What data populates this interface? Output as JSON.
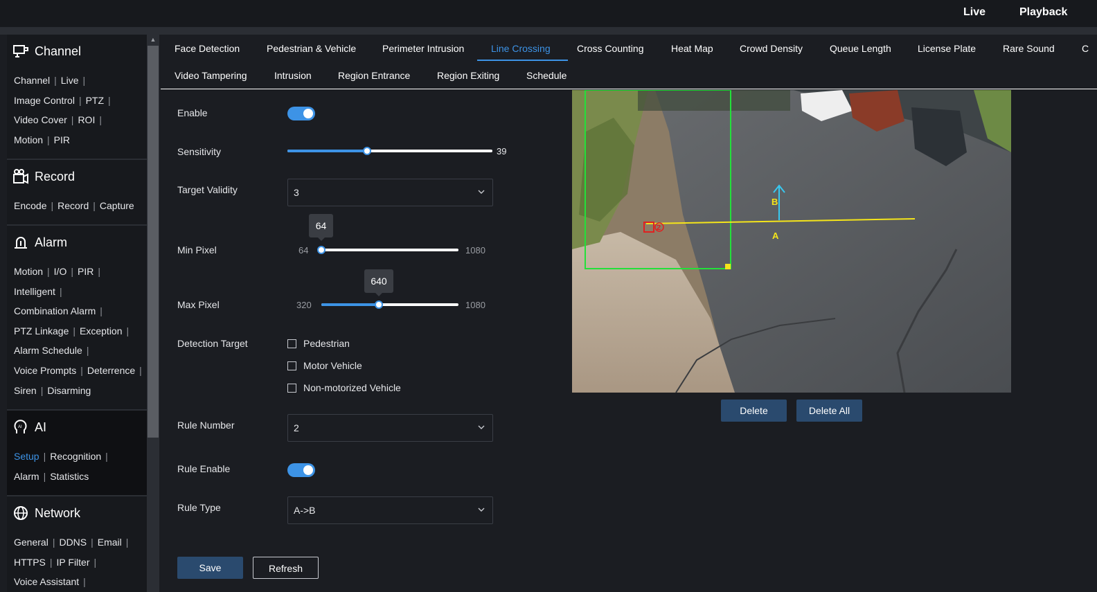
{
  "topnav": {
    "live": "Live",
    "playback": "Playback"
  },
  "sidebar": {
    "channel": {
      "title": "Channel",
      "rows": [
        [
          "Channel",
          "Live"
        ],
        [
          "Image Control",
          "PTZ"
        ],
        [
          "Video Cover",
          "ROI"
        ],
        [
          "Motion",
          "PIR"
        ]
      ]
    },
    "record": {
      "title": "Record",
      "rows": [
        [
          "Encode",
          "Record",
          "Capture"
        ]
      ]
    },
    "alarm": {
      "title": "Alarm",
      "rows": [
        [
          "Motion",
          "I/O",
          "PIR"
        ],
        [
          "Intelligent"
        ],
        [
          "Combination Alarm"
        ],
        [
          "PTZ Linkage",
          "Exception"
        ],
        [
          "Alarm Schedule"
        ],
        [
          "Voice Prompts",
          "Deterrence"
        ],
        [
          "Siren",
          "Disarming"
        ]
      ]
    },
    "ai": {
      "title": "AI",
      "rows": [
        [
          "Setup",
          "Recognition"
        ],
        [
          "Alarm",
          "Statistics"
        ]
      ],
      "selected": "Setup"
    },
    "network": {
      "title": "Network",
      "rows": [
        [
          "General",
          "DDNS",
          "Email"
        ],
        [
          "HTTPS",
          "IP Filter"
        ],
        [
          "Voice Assistant"
        ]
      ]
    }
  },
  "tabs": {
    "row1": [
      "Face Detection",
      "Pedestrian & Vehicle",
      "Perimeter Intrusion",
      "Line Crossing",
      "Cross Counting",
      "Heat Map",
      "Crowd Density",
      "Queue Length",
      "License Plate",
      "Rare Sound",
      "C"
    ],
    "row2": [
      "Video Tampering",
      "Intrusion",
      "Region Entrance",
      "Region Exiting",
      "Schedule"
    ],
    "active": "Line Crossing"
  },
  "form": {
    "enable_label": "Enable",
    "enable_on": true,
    "sensitivity_label": "Sensitivity",
    "sensitivity_value": "39",
    "sensitivity_fraction": 0.39,
    "target_validity_label": "Target Validity",
    "target_validity_value": "3",
    "min_pixel_label": "Min Pixel",
    "min_pixel_min": "64",
    "min_pixel_max": "1080",
    "min_pixel_value": "64",
    "max_pixel_label": "Max Pixel",
    "max_pixel_min": "320",
    "max_pixel_max": "1080",
    "max_pixel_value": "640",
    "detection_target_label": "Detection Target",
    "detection_targets": [
      "Pedestrian",
      "Motor Vehicle",
      "Non-motorized Vehicle"
    ],
    "rule_number_label": "Rule Number",
    "rule_number_value": "2",
    "rule_enable_label": "Rule Enable",
    "rule_enable_on": true,
    "rule_type_label": "Rule Type",
    "rule_type_value": "A->B",
    "save": "Save",
    "refresh": "Refresh"
  },
  "video": {
    "line_label_a": "A",
    "line_label_b": "B",
    "rule_marker": "2",
    "delete": "Delete",
    "delete_all": "Delete All"
  },
  "colors": {
    "accent": "#3d93e6",
    "primary_button": "#2a4a6e",
    "detection_zone": "#23e03a",
    "crossing_line": "#f5e51a",
    "direction_arrow": "#38c9f0",
    "rule_marker": "#e02020"
  }
}
